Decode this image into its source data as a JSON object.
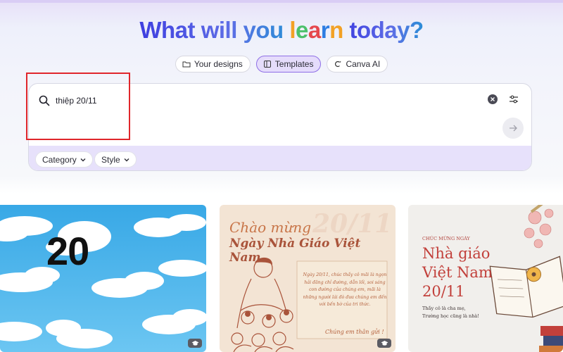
{
  "hero": {
    "prefix": "What will you ",
    "learn_l": "l",
    "learn_e": "e",
    "learn_a": "a",
    "learn_r": "r",
    "learn_n": "n",
    "suffix": " today?"
  },
  "tabs": [
    {
      "label": "Your designs",
      "icon": "folder-icon",
      "active": false
    },
    {
      "label": "Templates",
      "icon": "template-icon",
      "active": true
    },
    {
      "label": "Canva AI",
      "icon": "canva-ai-icon",
      "active": false
    }
  ],
  "search": {
    "value": "thiệp 20/11"
  },
  "filters": [
    {
      "label": "Category"
    },
    {
      "label": "Style"
    }
  ],
  "colors": {
    "accent": "#8b5cf6",
    "highlight_box": "#e0262b",
    "filter_bar": "#e7e1fb"
  },
  "templates": [
    {
      "big_text": "20"
    },
    {
      "title_line1": "Chào mừng",
      "year": "20/11",
      "title_line2": "Ngày Nhà Giáo Việt Nam",
      "note": "Ngày 20/11, chúc thầy cô mãi là ngọn hải đăng chỉ đường, dẫn lối, soi sáng con đường của chúng em, mãi là những người lái đò đưa chúng em đến với bến bờ của tri thức.",
      "signature": "Chúng em thân gửi !"
    },
    {
      "small": "CHÚC MỪNG NGÀY",
      "line1": "Nhà giáo",
      "line2": "Việt Nam",
      "line3": "20/11",
      "sub1": "Thầy cô là cha mẹ,",
      "sub2": "Trường học cũng là nhà!"
    }
  ]
}
